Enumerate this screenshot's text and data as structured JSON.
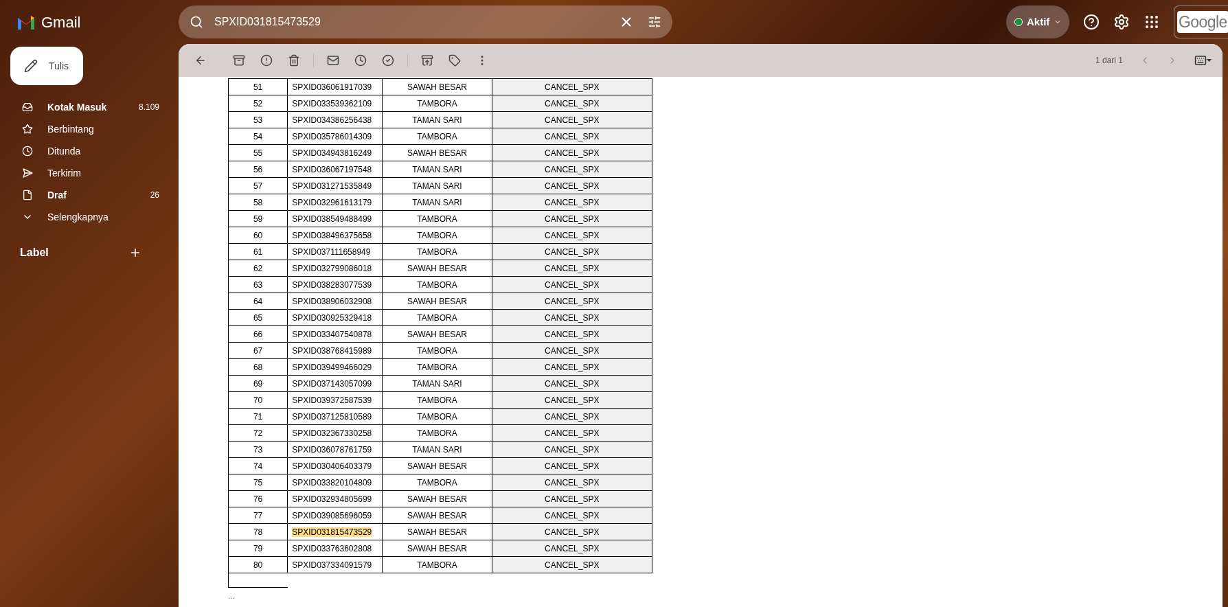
{
  "app": {
    "name": "Gmail"
  },
  "search": {
    "value": "SPXID031815473529"
  },
  "compose": {
    "label": "Tulis"
  },
  "nav": [
    {
      "kind": "inbox",
      "label": "Kotak Masuk",
      "count": "8.109",
      "unread": true
    },
    {
      "kind": "star",
      "label": "Berbintang",
      "unread": false
    },
    {
      "kind": "clock",
      "label": "Ditunda",
      "unread": false
    },
    {
      "kind": "sent",
      "label": "Terkirim",
      "unread": false
    },
    {
      "kind": "file",
      "label": "Draf",
      "count": "26",
      "unread": true
    },
    {
      "kind": "more",
      "label": "Selengkapnya",
      "unread": false
    }
  ],
  "labels": {
    "title": "Label"
  },
  "status": {
    "label": "Aktif",
    "color": "#1e8e3e"
  },
  "account": {
    "logo": "Google"
  },
  "pager": {
    "text": "1 dari 1"
  },
  "rows": [
    {
      "no": "51",
      "id": "SPXID036061917039",
      "area": "SAWAH BESAR",
      "status": "CANCEL_SPX",
      "highlighted": false
    },
    {
      "no": "52",
      "id": "SPXID033539362109",
      "area": "TAMBORA",
      "status": "CANCEL_SPX",
      "highlighted": false
    },
    {
      "no": "53",
      "id": "SPXID034386256438",
      "area": "TAMAN SARI",
      "status": "CANCEL_SPX",
      "highlighted": false
    },
    {
      "no": "54",
      "id": "SPXID035786014309",
      "area": "TAMBORA",
      "status": "CANCEL_SPX",
      "highlighted": false
    },
    {
      "no": "55",
      "id": "SPXID034943816249",
      "area": "SAWAH BESAR",
      "status": "CANCEL_SPX",
      "highlighted": false
    },
    {
      "no": "56",
      "id": "SPXID036067197548",
      "area": "TAMAN SARI",
      "status": "CANCEL_SPX",
      "highlighted": false
    },
    {
      "no": "57",
      "id": "SPXID031271535849",
      "area": "TAMAN SARI",
      "status": "CANCEL_SPX",
      "highlighted": false
    },
    {
      "no": "58",
      "id": "SPXID032961613179",
      "area": "TAMAN SARI",
      "status": "CANCEL_SPX",
      "highlighted": false
    },
    {
      "no": "59",
      "id": "SPXID038549488499",
      "area": "TAMBORA",
      "status": "CANCEL_SPX",
      "highlighted": false
    },
    {
      "no": "60",
      "id": "SPXID038496375658",
      "area": "TAMBORA",
      "status": "CANCEL_SPX",
      "highlighted": false
    },
    {
      "no": "61",
      "id": "SPXID037111658949",
      "area": "TAMBORA",
      "status": "CANCEL_SPX",
      "highlighted": false
    },
    {
      "no": "62",
      "id": "SPXID032799086018",
      "area": "SAWAH BESAR",
      "status": "CANCEL_SPX",
      "highlighted": false
    },
    {
      "no": "63",
      "id": "SPXID038283077539",
      "area": "TAMBORA",
      "status": "CANCEL_SPX",
      "highlighted": false
    },
    {
      "no": "64",
      "id": "SPXID038906032908",
      "area": "SAWAH BESAR",
      "status": "CANCEL_SPX",
      "highlighted": false
    },
    {
      "no": "65",
      "id": "SPXID030925329418",
      "area": "TAMBORA",
      "status": "CANCEL_SPX",
      "highlighted": false
    },
    {
      "no": "66",
      "id": "SPXID033407540878",
      "area": "SAWAH BESAR",
      "status": "CANCEL_SPX",
      "highlighted": false
    },
    {
      "no": "67",
      "id": "SPXID038768415989",
      "area": "TAMBORA",
      "status": "CANCEL_SPX",
      "highlighted": false
    },
    {
      "no": "68",
      "id": "SPXID039499466029",
      "area": "TAMBORA",
      "status": "CANCEL_SPX",
      "highlighted": false
    },
    {
      "no": "69",
      "id": "SPXID037143057099",
      "area": "TAMAN SARI",
      "status": "CANCEL_SPX",
      "highlighted": false
    },
    {
      "no": "70",
      "id": "SPXID039372587539",
      "area": "TAMBORA",
      "status": "CANCEL_SPX",
      "highlighted": false
    },
    {
      "no": "71",
      "id": "SPXID037125810589",
      "area": "TAMBORA",
      "status": "CANCEL_SPX",
      "highlighted": false
    },
    {
      "no": "72",
      "id": "SPXID032367330258",
      "area": "TAMBORA",
      "status": "CANCEL_SPX",
      "highlighted": false
    },
    {
      "no": "73",
      "id": "SPXID036078761759",
      "area": "TAMAN SARI",
      "status": "CANCEL_SPX",
      "highlighted": false
    },
    {
      "no": "74",
      "id": "SPXID030406403379",
      "area": "SAWAH BESAR",
      "status": "CANCEL_SPX",
      "highlighted": false
    },
    {
      "no": "75",
      "id": "SPXID033820104809",
      "area": "TAMBORA",
      "status": "CANCEL_SPX",
      "highlighted": false
    },
    {
      "no": "76",
      "id": "SPXID032934805699",
      "area": "SAWAH BESAR",
      "status": "CANCEL_SPX",
      "highlighted": false
    },
    {
      "no": "77",
      "id": "SPXID039085696059",
      "area": "SAWAH BESAR",
      "status": "CANCEL_SPX",
      "highlighted": false
    },
    {
      "no": "78",
      "id": "SPXID031815473529",
      "area": "SAWAH BESAR",
      "status": "CANCEL_SPX",
      "highlighted": true
    },
    {
      "no": "79",
      "id": "SPXID033763602808",
      "area": "SAWAH BESAR",
      "status": "CANCEL_SPX",
      "highlighted": false
    },
    {
      "no": "80",
      "id": "SPXID037334091579",
      "area": "TAMBORA",
      "status": "CANCEL_SPX",
      "highlighted": false
    }
  ],
  "trimmed": {
    "text": "..."
  }
}
